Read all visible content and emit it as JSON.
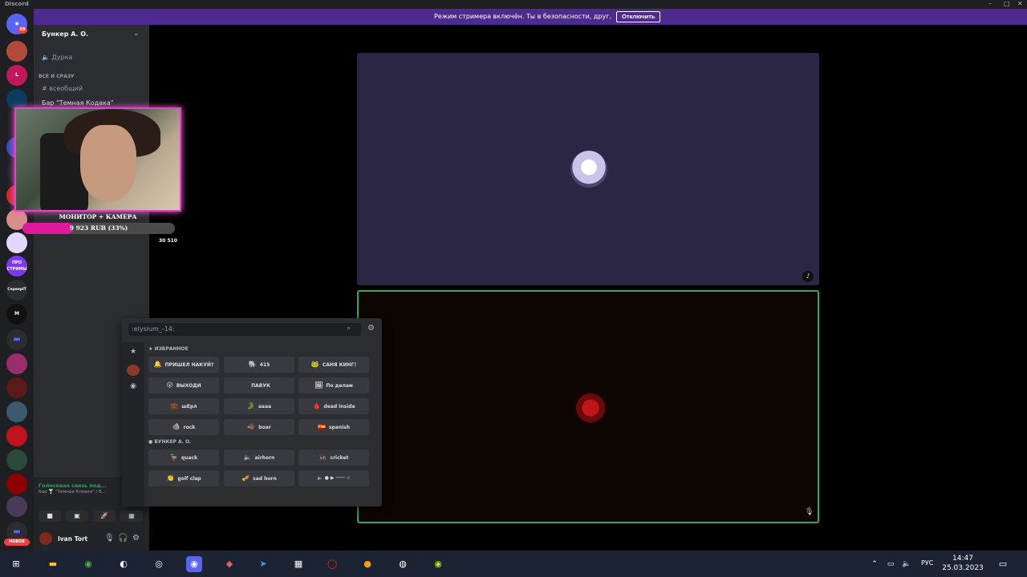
{
  "window": {
    "title": "Discord"
  },
  "banner": {
    "text": "Режим стримера включён. Ты в безопасности, друг.",
    "button": "Отключить"
  },
  "guilds": {
    "badge_top": "89",
    "new_badge": "НОВОЕ",
    "server_label_pro": "ПРО СТРИМЫ",
    "server_label_it": "СерверIT"
  },
  "server": {
    "name": "Бункер А. О.",
    "voice_top": "Дурка",
    "category": "ВСЕ И СРАЗУ",
    "text_channel": "всеобщий",
    "partial_channel": "Бар \"Темная Кодака\""
  },
  "voice_panel": {
    "status": "Голосовая связь под...",
    "sub": "Бар 🍸 \"Темная Клоака\" / Б..."
  },
  "user": {
    "name": "Ivan Tort"
  },
  "overlay": {
    "monitor_label": "МОНИТОР + КАМЕРА",
    "goal_text": "9 923 RUB (33%)",
    "goal_fraction": 0.33,
    "goal_total": "30 510"
  },
  "soundboard": {
    "search_value": ":elysium_-14:",
    "favorites_title": "ИЗБРАННОЕ",
    "server_title": "БУНКЕР А. О.",
    "favorites": [
      {
        "e": "🔔",
        "label": "ПРИШЕЛ НАКУЙ?"
      },
      {
        "e": "🐘",
        "label": "415"
      },
      {
        "e": "🐸",
        "label": "САНЯ КИНГ!"
      },
      {
        "e": "😮",
        "label": "ВЫХОДИ"
      },
      {
        "e": "",
        "label": "ПАВУК"
      },
      {
        "e": "🖼",
        "label": "По делам"
      },
      {
        "e": "💼",
        "label": "шЕрл"
      },
      {
        "e": "🐊",
        "label": "аааа"
      },
      {
        "e": "🩸",
        "label": "dead inside"
      },
      {
        "e": "🪨",
        "label": "rock"
      },
      {
        "e": "🐗",
        "label": "boar"
      },
      {
        "e": "🇪🇸",
        "label": "spanish"
      }
    ],
    "server_sounds": [
      {
        "e": "🦆",
        "label": "quack"
      },
      {
        "e": "🔈",
        "label": "airhorn"
      },
      {
        "e": "🦗",
        "label": "cricket"
      },
      {
        "e": "👏",
        "label": "golf clap"
      },
      {
        "e": "🎺",
        "label": "sad horn"
      }
    ]
  },
  "taskbar": {
    "lang": "РУС",
    "time": "14:47",
    "date": "25.03.2023"
  }
}
